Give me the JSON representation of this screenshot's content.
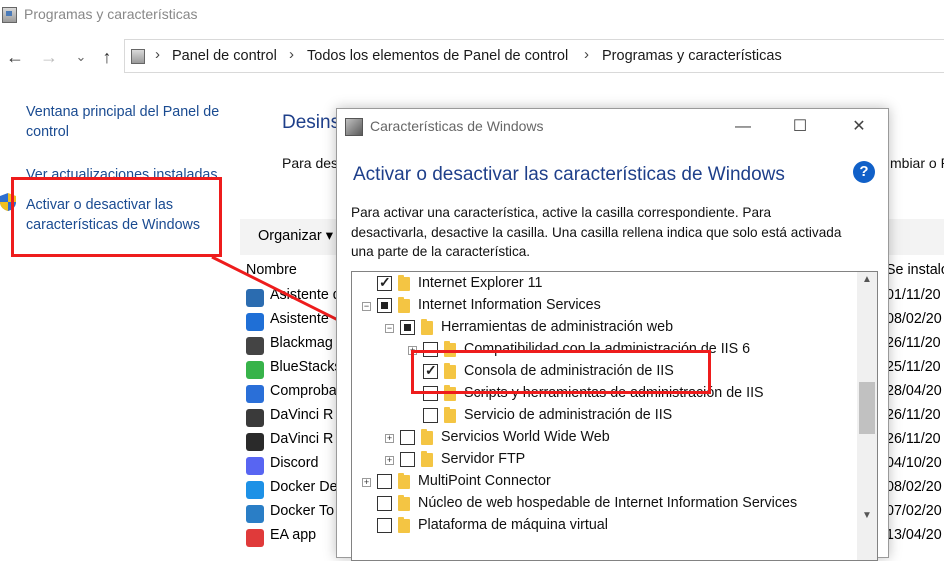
{
  "window": {
    "title": "Programas y características"
  },
  "nav": {
    "back_icon": "←",
    "forward_icon": "→",
    "recent_icon": "⌄",
    "up_icon": "↑"
  },
  "breadcrumb": [
    "Panel de control",
    "Todos los elementos de Panel de control",
    "Programas y características"
  ],
  "sidebar": {
    "items": [
      {
        "label": "Ventana principal del Panel de control"
      },
      {
        "label": "Ver actualizaciones instaladas"
      },
      {
        "label": "Activar o desactivar las características de Windows"
      }
    ]
  },
  "main": {
    "title": "Desins",
    "description": "Para des",
    "description_right": "mbiar o R",
    "toolbar": {
      "organize_label": "Organizar",
      "organize_arrow": "▾"
    },
    "columns": {
      "name": "Nombre",
      "installed": "Se instalo"
    },
    "programs": [
      {
        "name": "Asistente d",
        "date": "01/11/20",
        "color": "#2b6cb0"
      },
      {
        "name": "Asistente",
        "date": "08/02/20",
        "color": "#1f6fd6"
      },
      {
        "name": "Blackmag",
        "date": "26/11/20",
        "color": "#444444"
      },
      {
        "name": "BlueStacks",
        "date": "25/11/20",
        "color": "#37b34a"
      },
      {
        "name": "Comproba",
        "date": "28/04/20",
        "color": "#2a6fd8"
      },
      {
        "name": "DaVinci R",
        "date": "26/11/20",
        "color": "#3a3a3a"
      },
      {
        "name": "DaVinci R",
        "date": "26/11/20",
        "color": "#2a2a2a"
      },
      {
        "name": "Discord",
        "date": "04/10/20",
        "color": "#5865f2"
      },
      {
        "name": "Docker De",
        "date": "08/02/20",
        "color": "#1d91e6"
      },
      {
        "name": "Docker To",
        "date": "07/02/20",
        "color": "#2a7ec6"
      },
      {
        "name": "EA app",
        "date": "13/04/20",
        "color": "#e03a3a"
      }
    ]
  },
  "dialog": {
    "title": "Características de Windows",
    "minimize": "—",
    "maximize": "☐",
    "close": "✕",
    "heading": "Activar o desactivar las características de Windows",
    "help": "?",
    "description": "Para activar una característica, active la casilla correspondiente. Para desactivarla, desactive la casilla. Una casilla rellena indica que solo está activada una parte de la característica.",
    "tree": [
      {
        "label": "Internet Explorer 11",
        "state": "checked",
        "level": 0,
        "expander": ""
      },
      {
        "label": "Internet Information Services",
        "state": "partial",
        "level": 0,
        "expander": "−"
      },
      {
        "label": "Herramientas de administración web",
        "state": "partial",
        "level": 1,
        "expander": "−"
      },
      {
        "label": "Compatibilidad con la administración de IIS 6",
        "state": "unchecked",
        "level": 2,
        "expander": "+"
      },
      {
        "label": "Consola de administración de IIS",
        "state": "checked",
        "level": 2,
        "expander": ""
      },
      {
        "label": "Scripts y herramientas de administración de IIS",
        "state": "unchecked",
        "level": 2,
        "expander": ""
      },
      {
        "label": "Servicio de administración de IIS",
        "state": "unchecked",
        "level": 2,
        "expander": ""
      },
      {
        "label": "Servicios World Wide Web",
        "state": "unchecked",
        "level": 1,
        "expander": "+"
      },
      {
        "label": "Servidor FTP",
        "state": "unchecked",
        "level": 1,
        "expander": "+"
      },
      {
        "label": "MultiPoint Connector",
        "state": "unchecked",
        "level": 0,
        "expander": "+"
      },
      {
        "label": "Núcleo de web hospedable de Internet Information Services",
        "state": "unchecked",
        "level": 0,
        "expander": ""
      },
      {
        "label": "Plataforma de máquina virtual",
        "state": "unchecked",
        "level": 0,
        "expander": ""
      }
    ],
    "scroll_up": "▲",
    "scroll_down": "▼"
  },
  "colors": {
    "annotation_red": "#ee1c1c",
    "link_blue": "#1a4b91",
    "heading_blue": "#1e3f8a"
  }
}
